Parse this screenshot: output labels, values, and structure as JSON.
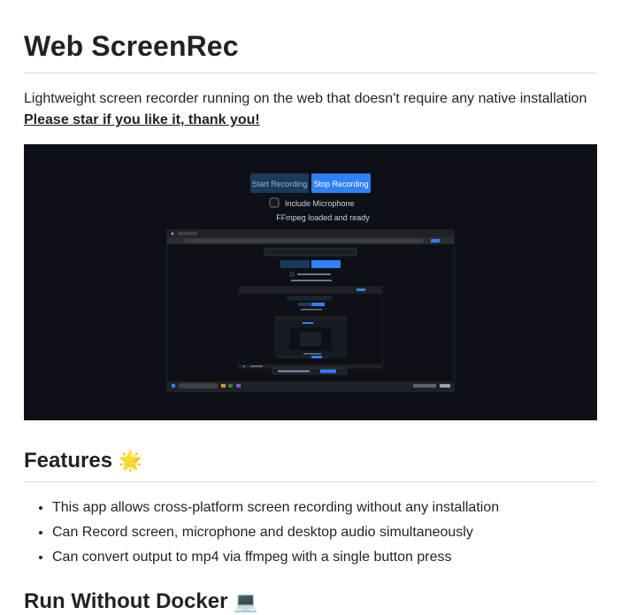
{
  "title": "Web ScreenRec",
  "description": "Lightweight screen recorder running on the web that doesn't require any native installation",
  "star_link": "Please star if you like it, thank you!",
  "screenshot": {
    "start_button": "Start Recording",
    "stop_button": "Stop Recording",
    "include_microphone": "Include Microphone",
    "status": "FFmpeg loaded and ready",
    "colors": {
      "background": "#0d1117",
      "start": "#1a3a5c",
      "stop": "#2f81f7"
    }
  },
  "features": {
    "heading": "Features",
    "heading_icon": "🌟",
    "items": [
      "This app allows cross-platform screen recording without any installation",
      "Can Record screen, microphone and desktop audio simultaneously",
      "Can convert output to mp4 via ffmpeg with a single button press"
    ]
  },
  "run_section": {
    "heading": "Run Without Docker",
    "heading_icon": "💻"
  }
}
